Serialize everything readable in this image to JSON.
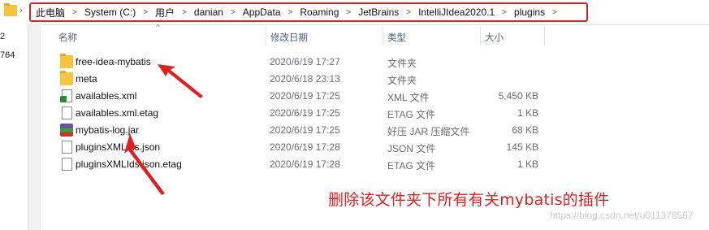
{
  "address_bar": {
    "crumbs": [
      "此电脑",
      "System (C:)",
      "用户",
      "danian",
      "AppData",
      "Roaming",
      "JetBrains",
      "IntelliJIdea2020.1",
      "plugins"
    ]
  },
  "nav": {
    "numbers": [
      "2",
      "764"
    ]
  },
  "columns": {
    "name": "名称",
    "date": "修改日期",
    "type": "类型",
    "size": "大小"
  },
  "files": [
    {
      "name": "free-idea-mybatis",
      "date": "2020/6/19 17:27",
      "type": "文件夹",
      "size": "",
      "icon": "folder-icon"
    },
    {
      "name": "meta",
      "date": "2020/6/18 23:13",
      "type": "文件夹",
      "size": "",
      "icon": "folder-icon"
    },
    {
      "name": "availables.xml",
      "date": "2020/6/19 17:25",
      "type": "XML 文件",
      "size": "5,450 KB",
      "icon": "xml-file-icon"
    },
    {
      "name": "availables.xml.etag",
      "date": "2020/6/19 17:25",
      "type": "ETAG 文件",
      "size": "1 KB",
      "icon": "file-icon"
    },
    {
      "name": "mybatis-log.jar",
      "date": "2020/6/19 17:25",
      "type": "好压 JAR 压缩文件",
      "size": "68 KB",
      "icon": "jar-archive-icon"
    },
    {
      "name": "pluginsXMLIds.json",
      "date": "2020/6/19 17:28",
      "type": "JSON 文件",
      "size": "145 KB",
      "icon": "file-icon"
    },
    {
      "name": "pluginsXMLIds.json.etag",
      "date": "2020/6/19 17:28",
      "type": "ETAG 文件",
      "size": "1 KB",
      "icon": "file-icon"
    }
  ],
  "annotation": {
    "text": "删除该文件夹下所有有关mybatis的插件",
    "color": "#e02020"
  },
  "watermark": "https://blog.csdn.net/u011378567"
}
